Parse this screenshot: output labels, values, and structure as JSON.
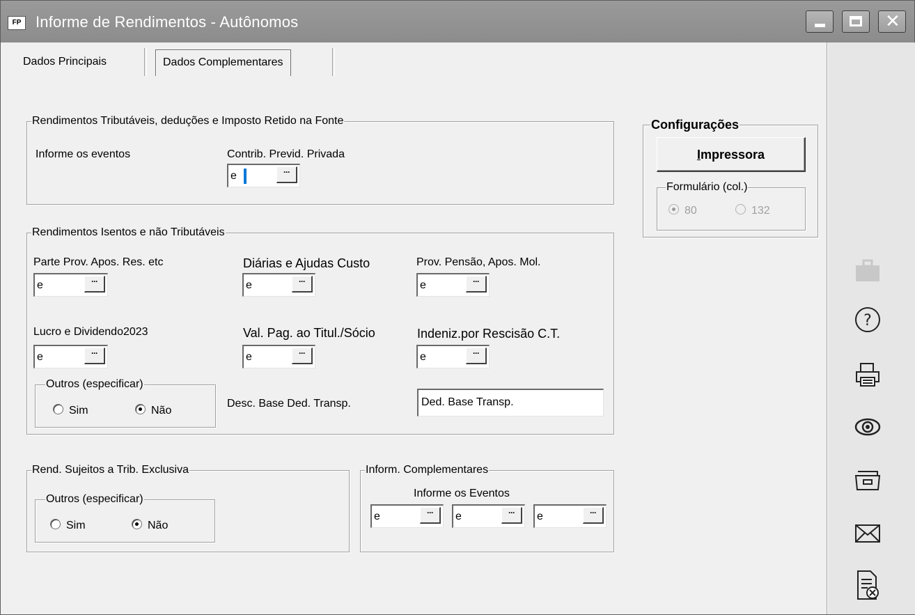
{
  "window": {
    "title": "Informe de Rendimentos - Autônomos",
    "app_badge": "FP"
  },
  "tabs": [
    {
      "label": "Dados Principais"
    },
    {
      "label": "Dados Complementares"
    }
  ],
  "rend_tributaveis": {
    "legend": "Rendimentos Tributáveis, deduções e Imposto Retido na Fonte",
    "informe_label": "Informe os eventos",
    "contrib_label": "Contrib. Previd. Privada",
    "contrib_value": "e",
    "lookup_glyph": "···"
  },
  "rend_isentos": {
    "legend": "Rendimentos Isentos e não Tributáveis",
    "parte_prov_label": "Parte Prov. Apos. Res. etc",
    "parte_prov_value": "e",
    "diarias_label": "Diárias e Ajudas Custo",
    "diarias_value": "e",
    "prov_pensao_label": "Prov. Pensão, Apos. Mol.",
    "prov_pensao_value": "e",
    "lucro_label": "Lucro e Dividendo2023",
    "lucro_value": "e",
    "val_pag_label": "Val. Pag. ao Titul./Sócio",
    "val_pag_value": "e",
    "indeniz_label": "Indeniz.por Rescisão C.T.",
    "indeniz_value": "e",
    "outros_legend": "Outros (especificar)",
    "sim_label": "Sim",
    "nao_label": "Não",
    "desc_base_label": "Desc. Base Ded. Transp.",
    "desc_base_value": "Ded. Base Transp."
  },
  "rend_exclusiva": {
    "legend": "Rend. Sujeitos a Trib. Exclusiva",
    "outros_legend": "Outros (especificar)",
    "sim_label": "Sim",
    "nao_label": "Não"
  },
  "inform_complementares": {
    "legend": "Inform. Complementares",
    "sub_label": "Informe os Eventos",
    "values": [
      "e",
      "e",
      "e"
    ]
  },
  "configuracoes": {
    "legend": "Configurações",
    "printer_button_rest": "mpressora",
    "printer_button_accel": "I",
    "formulario_legend": "Formulário (col.)",
    "opt_80": "80",
    "opt_132": "132"
  },
  "sidebar_icons": [
    "briefcase-icon",
    "help-icon",
    "printer-icon",
    "preview-eye-icon",
    "file-drawer-icon",
    "email-icon",
    "document-close-icon"
  ],
  "colors": {
    "titlebar": "#8c8c8c",
    "window_bg": "#f0f0f0",
    "caret": "#0078d7"
  }
}
